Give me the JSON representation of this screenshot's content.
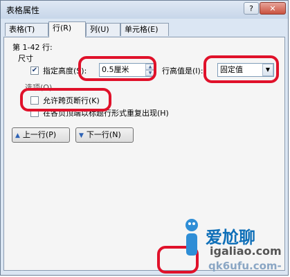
{
  "dialog": {
    "title": "表格属性",
    "help_glyph": "?",
    "close_glyph": "✕"
  },
  "tabs": [
    {
      "label": "表格(T)"
    },
    {
      "label": "行(R)"
    },
    {
      "label": "列(U)"
    },
    {
      "label": "单元格(E)"
    }
  ],
  "row": {
    "range_label": "第 1-42 行:",
    "size_heading": "尺寸",
    "specify_height_label": "指定高度(S):",
    "specify_height_checked": true,
    "height_value": "0.5厘米",
    "height_rule_label": "行高值是(I):",
    "height_rule_value": "固定值",
    "options_heading": "选项(O)",
    "allow_break_label": "允许跨页断行(K)",
    "allow_break_checked": false,
    "repeat_header_label": "在各页顶端以标题行形式重复出现(H)",
    "repeat_header_checked": false,
    "prev_row_label": "上一行(P)",
    "next_row_label": "下一行(N)"
  },
  "watermark": {
    "text_cn": "爱尬聊",
    "text_url": "igaliao.com",
    "text_url2": "qk6ufu.com-"
  },
  "colors": {
    "annotation_red": "#e0112a",
    "window_bg": "#dbe6f3",
    "accent_blue": "#2d62b5"
  }
}
